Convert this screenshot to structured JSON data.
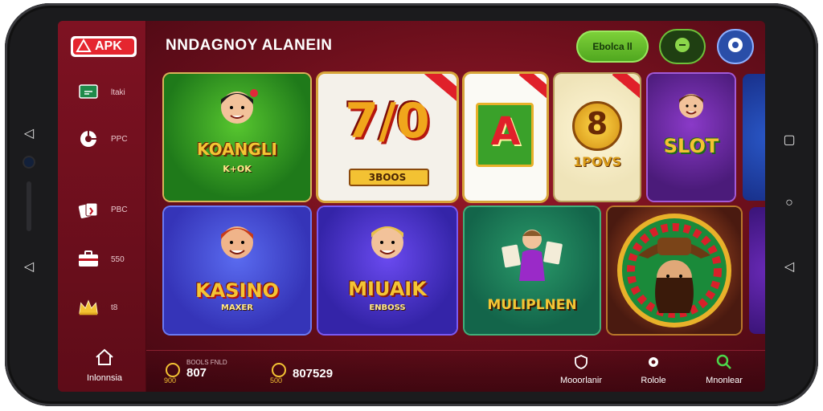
{
  "app": {
    "logo_text": "APK",
    "title": "NNDAGNOY ALANEIN"
  },
  "header": {
    "primary_button_label": "Ebolca ll"
  },
  "sidebar": {
    "items": [
      {
        "label": "ltaki",
        "icon": "chat-icon"
      },
      {
        "label": "PPC",
        "icon": "rocket-icon"
      },
      {
        "label": "PBC",
        "icon": "cards-icon"
      },
      {
        "label": "550",
        "icon": "briefcase-icon"
      },
      {
        "label": "t8",
        "icon": "crown-icon"
      }
    ],
    "home_label": "Inlonnsia"
  },
  "tiles": [
    {
      "title": "KOANGLI",
      "subtitle": "K+OK",
      "bg": "#1f7a1a"
    },
    {
      "title": "7/0",
      "subtitle": "3BOOS",
      "bg": "#f4f1ea"
    },
    {
      "title": "A",
      "subtitle": "",
      "bg": "#fbfaf5"
    },
    {
      "title": "8",
      "subtitle": "1POVS",
      "bg": "#efe4b9"
    },
    {
      "title": "SLOT",
      "subtitle": "",
      "bg": "#4b1b7a"
    },
    {
      "title": "KASINO",
      "subtitle": "MAXER",
      "bg": "#3534b8"
    },
    {
      "title": "MIUAIK",
      "subtitle": "ENBOSS",
      "bg": "#3424a8"
    },
    {
      "title": "MULIPLNEN",
      "subtitle": "",
      "bg": "#13654a"
    },
    {
      "title": "",
      "subtitle": "",
      "bg": "#4a1a10"
    }
  ],
  "bottom": {
    "stat1_small": "BOOLS FNLD",
    "stat1_coin": "900",
    "stat1_value": "807",
    "stat2_coin": "500",
    "stat2_value": "807529",
    "nav": [
      {
        "label": "Mooorlanir",
        "icon": "shield-icon"
      },
      {
        "label": "Rolole",
        "icon": "settings-icon"
      },
      {
        "label": "Mnonlear",
        "icon": "search-icon"
      }
    ]
  },
  "colors": {
    "accent_green": "#5cb82a",
    "brand_red": "#d6202c",
    "gold": "#f3c233"
  }
}
